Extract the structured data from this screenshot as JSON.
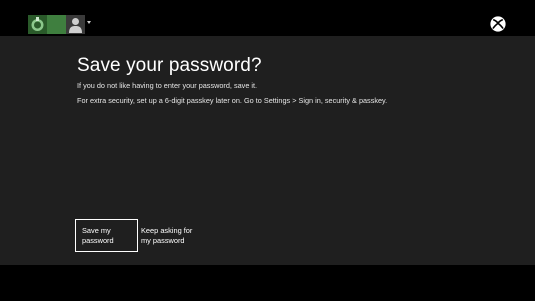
{
  "header": {
    "gamerpic_icons": [
      "xbox-avatar-icon",
      "gamerpic-icon",
      "person-silhouette-icon"
    ],
    "account_menu_icon": "chevron-down-icon",
    "logo_icon": "xbox-logo-icon"
  },
  "dialog": {
    "title": "Save your password?",
    "line1": "If you do not like having to enter your password, save it.",
    "line2": "For extra security, set up a 6-digit passkey later on. Go to Settings > Sign in, security & passkey."
  },
  "buttons": {
    "save": {
      "line1": "Save my",
      "line2": "password"
    },
    "keep": {
      "line1": "Keep asking for",
      "line2": "my password"
    }
  },
  "colors": {
    "background": "#000000",
    "panel": "#1f1f1f",
    "text": "#ffffff",
    "focus_border": "#ffffff",
    "gamerpic_green": "#3f7f3f"
  }
}
